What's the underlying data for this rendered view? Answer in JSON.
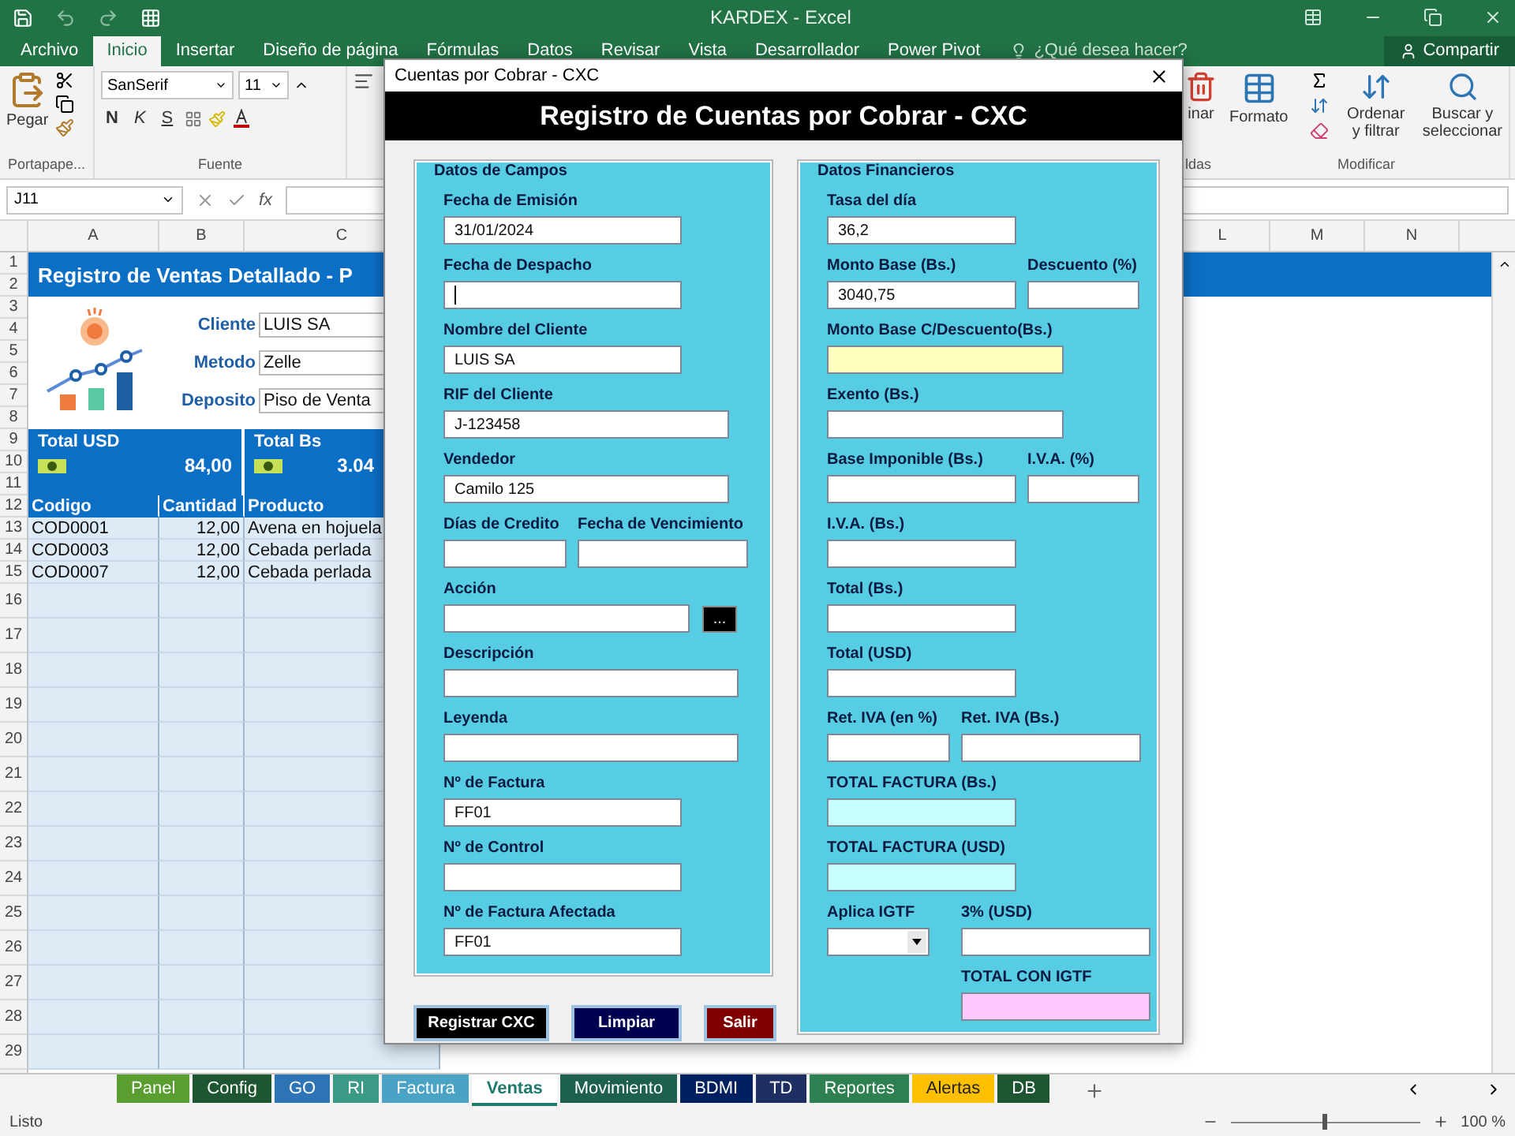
{
  "window": {
    "title": "KARDEX - Excel"
  },
  "ribbon_tabs": [
    {
      "label": "Archivo",
      "selected": false
    },
    {
      "label": "Inicio",
      "selected": true
    },
    {
      "label": "Insertar",
      "selected": false
    },
    {
      "label": "Diseño de página",
      "selected": false
    },
    {
      "label": "Fórmulas",
      "selected": false
    },
    {
      "label": "Datos",
      "selected": false
    },
    {
      "label": "Revisar",
      "selected": false
    },
    {
      "label": "Vista",
      "selected": false
    },
    {
      "label": "Desarrollador",
      "selected": false
    },
    {
      "label": "Power Pivot",
      "selected": false
    }
  ],
  "tell_me": "¿Qué desea hacer?",
  "share": "Compartir",
  "ribbon": {
    "paste": "Pegar",
    "font": "SanSerif",
    "font_size": "11",
    "bold": "N",
    "italic": "K",
    "underline": "S",
    "clipboard_group": "Portapape...",
    "font_group": "Fuente",
    "delete_partial": "inar",
    "format": "Formato",
    "cells_group_partial": "ldas",
    "sort": "Ordenar y filtrar",
    "find": "Buscar y seleccionar",
    "edit_group": "Modificar"
  },
  "formula_bar": {
    "name_box": "J11",
    "function_label": "fx"
  },
  "columns_left": [
    "A",
    "B",
    "C"
  ],
  "columns_right": [
    "L",
    "M",
    "N"
  ],
  "row_numbers": [
    "1",
    "2",
    "3",
    "4",
    "5",
    "6",
    "7",
    "8",
    "9",
    "10",
    "11",
    "12",
    "13",
    "14",
    "15",
    "16",
    "17",
    "18",
    "19",
    "20",
    "21",
    "22",
    "23",
    "24",
    "25",
    "26",
    "27",
    "28",
    "29"
  ],
  "sheet": {
    "banner": "Registro de Ventas Detallado - P",
    "info": [
      {
        "label": "Cliente",
        "value": "LUIS SA"
      },
      {
        "label": "Metodo",
        "value": "Zelle"
      },
      {
        "label": "Deposito",
        "value": "Piso de Venta"
      }
    ],
    "totals": [
      {
        "label": "Total USD",
        "value": "84,00"
      },
      {
        "label": "Total Bs",
        "value": "3.04"
      }
    ],
    "table": {
      "columns": [
        "Codigo",
        "Cantidad",
        "Producto"
      ],
      "rows": [
        [
          "COD0001",
          "12,00",
          "Avena en hojuela"
        ],
        [
          "COD0003",
          "12,00",
          "Cebada perlada"
        ],
        [
          "COD0007",
          "12,00",
          "Cebada perlada"
        ]
      ]
    }
  },
  "dialog": {
    "title": "Cuentas por Cobrar - CXC",
    "header": "Registro de Cuentas por Cobrar - CXC",
    "sections": [
      {
        "title": "Datos de Campos",
        "rows": [
          {
            "fields": [
              {
                "label": "Fecha de Emisión",
                "value": "31/01/2024",
                "kind": "text"
              }
            ]
          },
          {
            "fields": [
              {
                "label": "Fecha de Despacho",
                "kind": "text",
                "focused": true
              }
            ]
          },
          {
            "fields": [
              {
                "label": "Nombre del Cliente",
                "value": "LUIS SA",
                "kind": "text"
              }
            ]
          },
          {
            "fields": [
              {
                "label": "RIF del Cliente",
                "value": "J-123458",
                "kind": "text"
              }
            ]
          },
          {
            "fields": [
              {
                "label": "Vendedor",
                "value": "Camilo 125",
                "kind": "text"
              }
            ]
          },
          {
            "fields": [
              {
                "label": "Días de Credito",
                "kind": "text"
              },
              {
                "label": "Fecha de Vencimiento",
                "kind": "text"
              }
            ]
          },
          {
            "fields": [
              {
                "label": "Acción",
                "kind": "text",
                "button": "..."
              }
            ]
          },
          {
            "fields": [
              {
                "label": "Descripción",
                "kind": "text"
              }
            ]
          },
          {
            "fields": [
              {
                "label": "Leyenda",
                "kind": "text"
              }
            ]
          },
          {
            "fields": [
              {
                "label": "Nº de Factura",
                "value": "FF01",
                "kind": "text"
              }
            ]
          },
          {
            "fields": [
              {
                "label": "Nº de Control",
                "kind": "text"
              }
            ]
          },
          {
            "fields": [
              {
                "label": "Nº de Factura Afectada",
                "value": "FF01",
                "kind": "text"
              }
            ]
          }
        ]
      },
      {
        "title": "Datos Financieros",
        "rows": [
          {
            "fields": [
              {
                "label": "Tasa del día",
                "value": "36,2",
                "kind": "text"
              }
            ]
          },
          {
            "fields": [
              {
                "label": "Monto Base (Bs.)",
                "value": "3040,75",
                "kind": "text"
              },
              {
                "label": "Descuento (%)",
                "kind": "text"
              }
            ]
          },
          {
            "fields": [
              {
                "label": "Monto Base C/Descuento(Bs.)",
                "kind": "text",
                "color": "#ffffc0"
              }
            ]
          },
          {
            "fields": [
              {
                "label": "Exento (Bs.)",
                "kind": "text"
              }
            ]
          },
          {
            "fields": [
              {
                "label": "Base Imponible (Bs.)",
                "kind": "text"
              },
              {
                "label": "I.V.A. (%)",
                "kind": "text"
              }
            ]
          },
          {
            "fields": [
              {
                "label": "I.V.A. (Bs.)",
                "kind": "text"
              }
            ]
          },
          {
            "fields": [
              {
                "label": "Total (Bs.)",
                "kind": "text"
              }
            ]
          },
          {
            "fields": [
              {
                "label": "Total (USD)",
                "kind": "text"
              }
            ]
          },
          {
            "fields": [
              {
                "label": "Ret. IVA (en %)",
                "kind": "text"
              },
              {
                "label": "Ret. IVA (Bs.)",
                "kind": "text"
              }
            ]
          },
          {
            "fields": [
              {
                "label": "TOTAL FACTURA (Bs.)",
                "kind": "text",
                "color": "#c8ffff"
              }
            ]
          },
          {
            "fields": [
              {
                "label": "TOTAL FACTURA (USD)",
                "kind": "text",
                "color": "#c8ffff"
              }
            ]
          },
          {
            "fields": [
              {
                "label": "Aplica IGTF",
                "kind": "dropdown"
              },
              {
                "label": "3% (USD)",
                "kind": "text"
              }
            ]
          },
          {
            "fields": [
              {
                "label": "TOTAL CON IGTF",
                "kind": "text",
                "color": "#ffc8ff"
              }
            ]
          }
        ]
      }
    ],
    "buttons": [
      {
        "label": "Registrar CXC",
        "color": "#000000"
      },
      {
        "label": "Limpiar",
        "color": "#000050"
      },
      {
        "label": "Salir",
        "color": "#800000"
      }
    ]
  },
  "sheet_tabs": [
    {
      "label": "Panel",
      "selected": false,
      "color": "#5a9e32"
    },
    {
      "label": "Config",
      "selected": false,
      "color": "#1e5631"
    },
    {
      "label": "GO",
      "selected": false,
      "color": "#2e75b6"
    },
    {
      "label": "RI",
      "selected": false,
      "color": "#3a9a86"
    },
    {
      "label": "Factura",
      "selected": false,
      "color": "#4aa3c4"
    },
    {
      "label": "Ventas",
      "selected": true
    },
    {
      "label": "Movimiento",
      "selected": false,
      "color": "#1e6050"
    },
    {
      "label": "BDMI",
      "selected": false,
      "color": "#002060"
    },
    {
      "label": "TD",
      "selected": false,
      "color": "#1f2f64"
    },
    {
      "label": "Reportes",
      "selected": false,
      "color": "#2e8050"
    },
    {
      "label": "Alertas",
      "selected": false,
      "color": "#ffc000"
    },
    {
      "label": "DB",
      "selected": false,
      "color": "#1e5631"
    }
  ],
  "status_bar": {
    "status": "Listo",
    "zoom_slider": {
      "level": 0.5
    },
    "zoom": "100 %"
  }
}
